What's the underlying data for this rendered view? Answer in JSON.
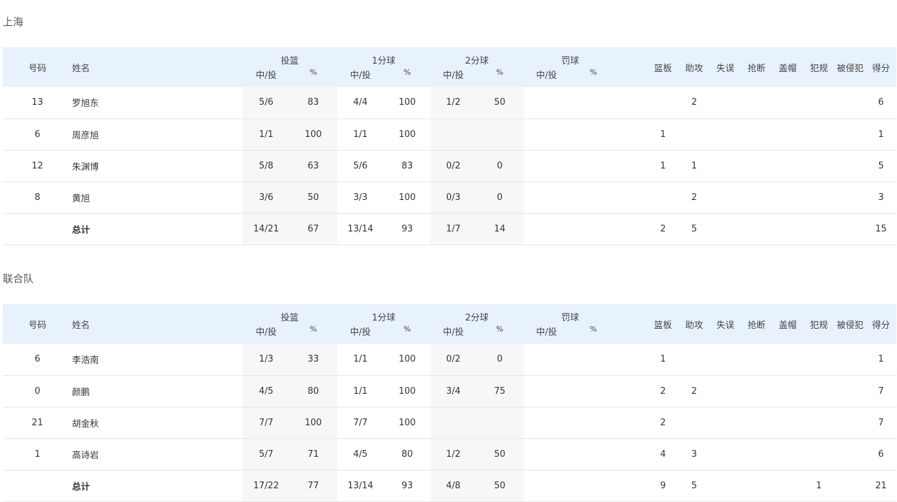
{
  "column_headers": {
    "number": "号码",
    "name": "姓名",
    "fg": "投篮",
    "one_pt": "1分球",
    "two_pt": "2分球",
    "ft": "罚球",
    "made_att": "中/投",
    "pct": "%",
    "rebounds": "篮板",
    "assists": "助攻",
    "turnovers": "失误",
    "steals": "抢断",
    "blocks": "盖帽",
    "fouls": "犯规",
    "fouled": "被侵犯",
    "points": "得分"
  },
  "teams": [
    {
      "name": "上海",
      "players": [
        {
          "number": "13",
          "name": "罗旭东",
          "fg": "5/6",
          "fg_pct": "83",
          "one": "4/4",
          "one_pct": "100",
          "two": "1/2",
          "two_pct": "50",
          "ft": "",
          "ft_pct": "",
          "reb": "",
          "ast": "2",
          "tov": "",
          "stl": "",
          "blk": "",
          "pf": "",
          "fd": "",
          "pts": "6"
        },
        {
          "number": "6",
          "name": "周彦旭",
          "fg": "1/1",
          "fg_pct": "100",
          "one": "1/1",
          "one_pct": "100",
          "two": "",
          "two_pct": "",
          "ft": "",
          "ft_pct": "",
          "reb": "1",
          "ast": "",
          "tov": "",
          "stl": "",
          "blk": "",
          "pf": "",
          "fd": "",
          "pts": "1"
        },
        {
          "number": "12",
          "name": "朱渊博",
          "fg": "5/8",
          "fg_pct": "63",
          "one": "5/6",
          "one_pct": "83",
          "two": "0/2",
          "two_pct": "0",
          "ft": "",
          "ft_pct": "",
          "reb": "1",
          "ast": "1",
          "tov": "",
          "stl": "",
          "blk": "",
          "pf": "",
          "fd": "",
          "pts": "5"
        },
        {
          "number": "8",
          "name": "黄旭",
          "fg": "3/6",
          "fg_pct": "50",
          "one": "3/3",
          "one_pct": "100",
          "two": "0/3",
          "two_pct": "0",
          "ft": "",
          "ft_pct": "",
          "reb": "",
          "ast": "2",
          "tov": "",
          "stl": "",
          "blk": "",
          "pf": "",
          "fd": "",
          "pts": "3"
        }
      ],
      "total": {
        "number": "",
        "name": "总计",
        "fg": "14/21",
        "fg_pct": "67",
        "one": "13/14",
        "one_pct": "93",
        "two": "1/7",
        "two_pct": "14",
        "ft": "",
        "ft_pct": "",
        "reb": "2",
        "ast": "5",
        "tov": "",
        "stl": "",
        "blk": "",
        "pf": "",
        "fd": "",
        "pts": "15"
      }
    },
    {
      "name": "联合队",
      "players": [
        {
          "number": "6",
          "name": "李浩南",
          "fg": "1/3",
          "fg_pct": "33",
          "one": "1/1",
          "one_pct": "100",
          "two": "0/2",
          "two_pct": "0",
          "ft": "",
          "ft_pct": "",
          "reb": "1",
          "ast": "",
          "tov": "",
          "stl": "",
          "blk": "",
          "pf": "",
          "fd": "",
          "pts": "1"
        },
        {
          "number": "0",
          "name": "颜鹏",
          "fg": "4/5",
          "fg_pct": "80",
          "one": "1/1",
          "one_pct": "100",
          "two": "3/4",
          "two_pct": "75",
          "ft": "",
          "ft_pct": "",
          "reb": "2",
          "ast": "2",
          "tov": "",
          "stl": "",
          "blk": "",
          "pf": "",
          "fd": "",
          "pts": "7"
        },
        {
          "number": "21",
          "name": "胡金秋",
          "fg": "7/7",
          "fg_pct": "100",
          "one": "7/7",
          "one_pct": "100",
          "two": "",
          "two_pct": "",
          "ft": "",
          "ft_pct": "",
          "reb": "2",
          "ast": "",
          "tov": "",
          "stl": "",
          "blk": "",
          "pf": "",
          "fd": "",
          "pts": "7"
        },
        {
          "number": "1",
          "name": "高诗岩",
          "fg": "5/7",
          "fg_pct": "71",
          "one": "4/5",
          "one_pct": "80",
          "two": "1/2",
          "two_pct": "50",
          "ft": "",
          "ft_pct": "",
          "reb": "4",
          "ast": "3",
          "tov": "",
          "stl": "",
          "blk": "",
          "pf": "",
          "fd": "",
          "pts": "6"
        }
      ],
      "total": {
        "number": "",
        "name": "总计",
        "fg": "17/22",
        "fg_pct": "77",
        "one": "13/14",
        "one_pct": "93",
        "two": "4/8",
        "two_pct": "50",
        "ft": "",
        "ft_pct": "",
        "reb": "9",
        "ast": "5",
        "tov": "",
        "stl": "",
        "blk": "",
        "pf": "1",
        "fd": "",
        "pts": "21"
      }
    }
  ]
}
